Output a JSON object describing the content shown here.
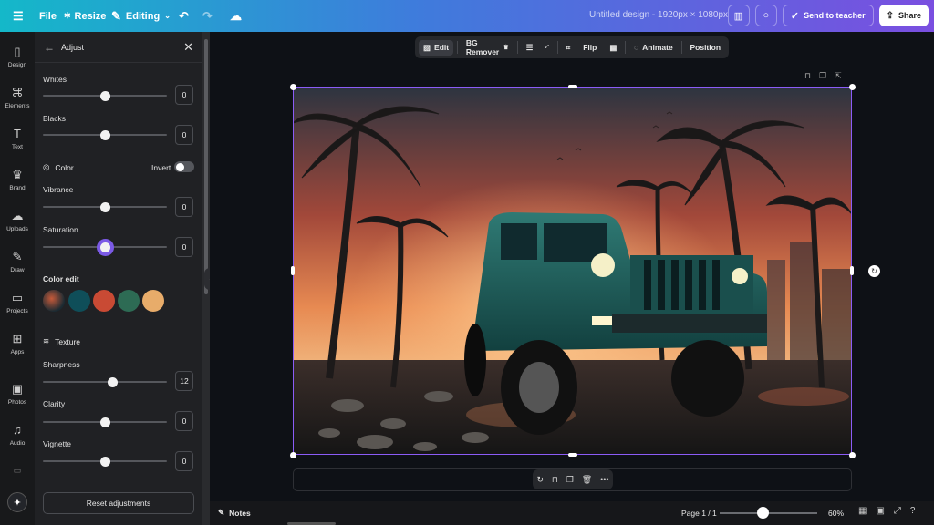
{
  "topbar": {
    "menu_icon": "hamburger-icon",
    "file_label": "File",
    "resize_label": "Resize",
    "editing_label": "Editing",
    "title": "Untitled design - 1920px × 1080px",
    "send_label": "Send to teacher",
    "share_label": "Share"
  },
  "rail": {
    "items": [
      {
        "label": "Design",
        "icon": "▯"
      },
      {
        "label": "Elements",
        "icon": "⌘"
      },
      {
        "label": "Text",
        "icon": "T"
      },
      {
        "label": "Brand",
        "icon": "♛"
      },
      {
        "label": "Uploads",
        "icon": "☁"
      },
      {
        "label": "Draw",
        "icon": "✎"
      },
      {
        "label": "Projects",
        "icon": "▭"
      },
      {
        "label": "Apps",
        "icon": "⊞"
      },
      {
        "label": "Photos",
        "icon": "▣"
      },
      {
        "label": "Audio",
        "icon": "♫"
      }
    ]
  },
  "panel": {
    "title": "Adjust",
    "whites": {
      "label": "Whites",
      "value": "0",
      "level": 0.5
    },
    "blacks": {
      "label": "Blacks",
      "value": "0",
      "level": 0.5
    },
    "color_section": "Color",
    "invert_label": "Invert",
    "vibrance": {
      "label": "Vibrance",
      "value": "0",
      "level": 0.5
    },
    "saturation": {
      "label": "Saturation",
      "value": "0",
      "level": 0.5
    },
    "color_edit_label": "Color edit",
    "swatches": [
      "#0f4e59",
      "#c94a34",
      "#2d6b54",
      "#e8ac6a"
    ],
    "texture_section": "Texture",
    "sharpness": {
      "label": "Sharpness",
      "value": "12",
      "level": 0.56
    },
    "clarity": {
      "label": "Clarity",
      "value": "0",
      "level": 0.5
    },
    "vignette": {
      "label": "Vignette",
      "value": "0",
      "level": 0.5
    },
    "reset_label": "Reset adjustments"
  },
  "context_toolbar": {
    "edit_label": "Edit",
    "bg_remover_label": "BG Remover",
    "flip_label": "Flip",
    "animate_label": "Animate",
    "position_label": "Position"
  },
  "bottombar": {
    "notes_label": "Notes",
    "page_info": "Page 1 / 1",
    "zoom_value": "60%",
    "zoom_level": 0.44
  },
  "colors": {
    "selection": "#8b5cf6",
    "accent_gradient_start": "#14b8c9",
    "accent_gradient_end": "#7a4fe0"
  }
}
